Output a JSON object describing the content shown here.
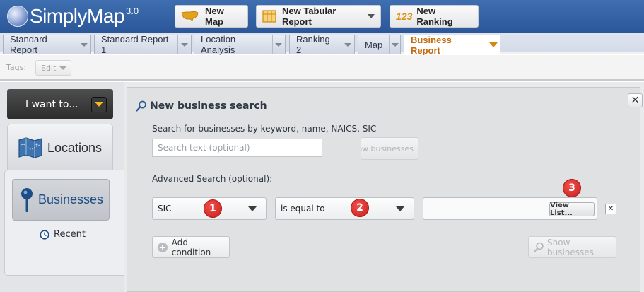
{
  "app": {
    "name": "SimplyMap",
    "version": "3.0"
  },
  "toolbar": {
    "new_map": "New Map",
    "new_tabular": "New Tabular Report",
    "new_ranking": "New Ranking",
    "ranking_glyph": "123"
  },
  "tabs": [
    {
      "label": "Standard Report",
      "active": false
    },
    {
      "label": "Standard Report 1",
      "active": false
    },
    {
      "label": "Location Analysis",
      "active": false
    },
    {
      "label": "Ranking 2",
      "active": false
    },
    {
      "label": "Map",
      "active": false
    },
    {
      "label": "Business Report",
      "active": true
    }
  ],
  "tags": {
    "label": "Tags:",
    "edit": "Edit"
  },
  "sidebar": {
    "i_want_to": "I want to...",
    "locations": "Locations",
    "businesses": "Businesses",
    "recent": "Recent"
  },
  "panel": {
    "title": "New business search",
    "description": "Search for businesses by keyword, name, NAICS, SIC",
    "search_placeholder": "Search text (optional)",
    "show_businesses_partial": "ow businesses",
    "advanced_label": "Advanced Search (optional):",
    "field_select": "SIC",
    "operator_select": "is equal to",
    "view_list": "View List...",
    "remove": "✕",
    "add_condition": "Add condition",
    "show_businesses": "Show businesses",
    "close": "✕"
  },
  "markers": [
    "1",
    "2",
    "3"
  ],
  "colors": {
    "topbar": "#2f5e9f",
    "active_tab_text": "#c46a10",
    "marker_red": "#d9302c",
    "businesses_blue": "#1d4d86",
    "accent_yellow": "#f2b81c"
  }
}
